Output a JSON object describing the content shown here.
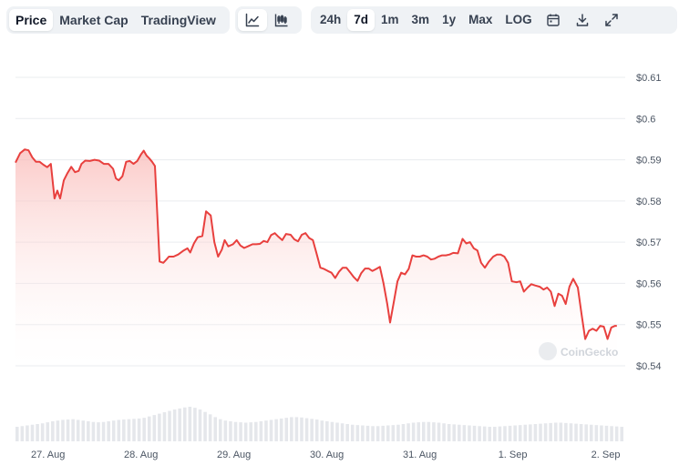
{
  "toolbar": {
    "data_tabs": [
      "Price",
      "Market Cap",
      "TradingView"
    ],
    "active_data_tab": "Price",
    "chart_style_icons": [
      "line-chart-icon",
      "candlestick-chart-icon"
    ],
    "active_chart_style": "line-chart-icon",
    "ranges": [
      "24h",
      "7d",
      "1m",
      "3m",
      "1y",
      "Max",
      "LOG"
    ],
    "active_range": "7d",
    "action_icons": [
      "calendar-icon",
      "download-icon",
      "expand-icon"
    ]
  },
  "watermark": "CoinGecko",
  "colors": {
    "line": "#e8403e",
    "fill_top": "#f9b4b1",
    "volume": "#e5e7eb",
    "grid": "#e9ecef",
    "active_bg": "#ffffff",
    "group_bg": "#eff2f5"
  },
  "chart_data": {
    "type": "area",
    "y_axis_side": "right",
    "ylim": [
      0.54,
      0.61
    ],
    "yticks": [
      0.54,
      0.55,
      0.56,
      0.57,
      0.58,
      0.59,
      0.6,
      0.61
    ],
    "ytick_labels": [
      "$0.54",
      "$0.55",
      "$0.56",
      "$0.57",
      "$0.58",
      "$0.59",
      "$0.6",
      "$0.61"
    ],
    "xlim": [
      -0.35,
      6.21
    ],
    "xticks": [
      0,
      1,
      2,
      3,
      4,
      5,
      6
    ],
    "xtick_labels": [
      "27. Aug",
      "28. Aug",
      "29. Aug",
      "30. Aug",
      "31. Aug",
      "1. Sep",
      "2. Sep"
    ],
    "grid": true,
    "series": [
      {
        "values": [
          [
            -0.35,
            0.5893
          ],
          [
            -0.3,
            0.5916
          ],
          [
            -0.25,
            0.5925
          ],
          [
            -0.21,
            0.5923
          ],
          [
            -0.17,
            0.5906
          ],
          [
            -0.13,
            0.5895
          ],
          [
            -0.09,
            0.5895
          ],
          [
            -0.05,
            0.5888
          ],
          [
            -0.01,
            0.5882
          ],
          [
            0.03,
            0.589
          ],
          [
            0.07,
            0.5806
          ],
          [
            0.1,
            0.5825
          ],
          [
            0.13,
            0.5806
          ],
          [
            0.17,
            0.585
          ],
          [
            0.21,
            0.5868
          ],
          [
            0.25,
            0.5883
          ],
          [
            0.29,
            0.587
          ],
          [
            0.33,
            0.5873
          ],
          [
            0.36,
            0.589
          ],
          [
            0.4,
            0.5898
          ],
          [
            0.45,
            0.5897
          ],
          [
            0.5,
            0.59
          ],
          [
            0.55,
            0.5898
          ],
          [
            0.6,
            0.589
          ],
          [
            0.65,
            0.589
          ],
          [
            0.7,
            0.5878
          ],
          [
            0.73,
            0.5855
          ],
          [
            0.76,
            0.585
          ],
          [
            0.8,
            0.586
          ],
          [
            0.84,
            0.5895
          ],
          [
            0.88,
            0.5897
          ],
          [
            0.92,
            0.589
          ],
          [
            0.96,
            0.5897
          ],
          [
            1.0,
            0.5913
          ],
          [
            1.03,
            0.5922
          ],
          [
            1.06,
            0.591
          ],
          [
            1.09,
            0.5903
          ],
          [
            1.12,
            0.5895
          ],
          [
            1.15,
            0.5885
          ],
          [
            1.2,
            0.5653
          ],
          [
            1.24,
            0.565
          ],
          [
            1.27,
            0.5657
          ],
          [
            1.3,
            0.5665
          ],
          [
            1.35,
            0.5665
          ],
          [
            1.4,
            0.567
          ],
          [
            1.46,
            0.568
          ],
          [
            1.5,
            0.5685
          ],
          [
            1.53,
            0.5675
          ],
          [
            1.57,
            0.5697
          ],
          [
            1.61,
            0.5712
          ],
          [
            1.66,
            0.5715
          ],
          [
            1.7,
            0.5775
          ],
          [
            1.75,
            0.5765
          ],
          [
            1.79,
            0.57
          ],
          [
            1.83,
            0.5665
          ],
          [
            1.87,
            0.5682
          ],
          [
            1.9,
            0.5705
          ],
          [
            1.94,
            0.569
          ],
          [
            1.99,
            0.5695
          ],
          [
            2.03,
            0.5705
          ],
          [
            2.07,
            0.5692
          ],
          [
            2.11,
            0.5686
          ],
          [
            2.15,
            0.569
          ],
          [
            2.2,
            0.5695
          ],
          [
            2.24,
            0.5695
          ],
          [
            2.28,
            0.5696
          ],
          [
            2.32,
            0.5703
          ],
          [
            2.36,
            0.57
          ],
          [
            2.4,
            0.5717
          ],
          [
            2.44,
            0.5722
          ],
          [
            2.48,
            0.5713
          ],
          [
            2.52,
            0.5705
          ],
          [
            2.56,
            0.572
          ],
          [
            2.61,
            0.5718
          ],
          [
            2.65,
            0.5707
          ],
          [
            2.69,
            0.5702
          ],
          [
            2.73,
            0.5718
          ],
          [
            2.77,
            0.5722
          ],
          [
            2.81,
            0.571
          ],
          [
            2.85,
            0.5705
          ],
          [
            2.89,
            0.5672
          ],
          [
            2.93,
            0.5638
          ],
          [
            2.97,
            0.5635
          ],
          [
            3.01,
            0.563
          ],
          [
            3.05,
            0.5626
          ],
          [
            3.09,
            0.5613
          ],
          [
            3.13,
            0.5628
          ],
          [
            3.17,
            0.5638
          ],
          [
            3.21,
            0.5638
          ],
          [
            3.25,
            0.5627
          ],
          [
            3.29,
            0.5615
          ],
          [
            3.33,
            0.5606
          ],
          [
            3.37,
            0.5625
          ],
          [
            3.41,
            0.5636
          ],
          [
            3.45,
            0.5636
          ],
          [
            3.49,
            0.563
          ],
          [
            3.53,
            0.5635
          ],
          [
            3.57,
            0.564
          ],
          [
            3.61,
            0.56
          ],
          [
            3.65,
            0.555
          ],
          [
            3.68,
            0.5505
          ],
          [
            3.72,
            0.5555
          ],
          [
            3.76,
            0.5605
          ],
          [
            3.8,
            0.5626
          ],
          [
            3.84,
            0.5622
          ],
          [
            3.88,
            0.5635
          ],
          [
            3.92,
            0.5668
          ],
          [
            3.96,
            0.5665
          ],
          [
            4.0,
            0.5665
          ],
          [
            4.04,
            0.5668
          ],
          [
            4.08,
            0.5665
          ],
          [
            4.12,
            0.5658
          ],
          [
            4.16,
            0.566
          ],
          [
            4.2,
            0.5665
          ],
          [
            4.24,
            0.5668
          ],
          [
            4.28,
            0.5668
          ],
          [
            4.32,
            0.567
          ],
          [
            4.36,
            0.5674
          ],
          [
            4.41,
            0.5673
          ],
          [
            4.46,
            0.5708
          ],
          [
            4.5,
            0.5697
          ],
          [
            4.54,
            0.57
          ],
          [
            4.58,
            0.5685
          ],
          [
            4.62,
            0.568
          ],
          [
            4.66,
            0.565
          ],
          [
            4.7,
            0.5638
          ],
          [
            4.74,
            0.5652
          ],
          [
            4.79,
            0.5665
          ],
          [
            4.83,
            0.567
          ],
          [
            4.87,
            0.567
          ],
          [
            4.91,
            0.5665
          ],
          [
            4.95,
            0.565
          ],
          [
            4.99,
            0.5605
          ],
          [
            5.04,
            0.5603
          ],
          [
            5.08,
            0.5605
          ],
          [
            5.12,
            0.558
          ],
          [
            5.16,
            0.559
          ],
          [
            5.2,
            0.5598
          ],
          [
            5.24,
            0.5595
          ],
          [
            5.29,
            0.5592
          ],
          [
            5.33,
            0.5585
          ],
          [
            5.37,
            0.559
          ],
          [
            5.41,
            0.558
          ],
          [
            5.45,
            0.5545
          ],
          [
            5.49,
            0.5575
          ],
          [
            5.53,
            0.557
          ],
          [
            5.57,
            0.555
          ],
          [
            5.61,
            0.5592
          ],
          [
            5.65,
            0.5611
          ],
          [
            5.7,
            0.559
          ],
          [
            5.74,
            0.5525
          ],
          [
            5.78,
            0.5465
          ],
          [
            5.82,
            0.5485
          ],
          [
            5.86,
            0.549
          ],
          [
            5.9,
            0.5485
          ],
          [
            5.94,
            0.5497
          ],
          [
            5.98,
            0.5495
          ],
          [
            6.02,
            0.5465
          ],
          [
            6.06,
            0.5493
          ],
          [
            6.1,
            0.5497
          ],
          [
            6.12,
            0.5497
          ]
        ]
      }
    ],
    "volume": {
      "start": -0.35,
      "end": 6.21,
      "values": [
        0.42,
        0.44,
        0.46,
        0.48,
        0.5,
        0.52,
        0.55,
        0.58,
        0.6,
        0.62,
        0.63,
        0.64,
        0.62,
        0.6,
        0.58,
        0.56,
        0.55,
        0.56,
        0.58,
        0.6,
        0.62,
        0.63,
        0.64,
        0.65,
        0.66,
        0.68,
        0.72,
        0.76,
        0.8,
        0.84,
        0.88,
        0.92,
        0.95,
        0.98,
        1.0,
        0.97,
        0.92,
        0.85,
        0.78,
        0.7,
        0.64,
        0.6,
        0.58,
        0.56,
        0.55,
        0.54,
        0.55,
        0.56,
        0.58,
        0.6,
        0.62,
        0.64,
        0.66,
        0.68,
        0.7,
        0.7,
        0.69,
        0.67,
        0.65,
        0.63,
        0.6,
        0.58,
        0.56,
        0.54,
        0.52,
        0.5,
        0.48,
        0.47,
        0.46,
        0.45,
        0.44,
        0.44,
        0.45,
        0.46,
        0.47,
        0.48,
        0.5,
        0.52,
        0.54,
        0.55,
        0.56,
        0.56,
        0.55,
        0.54,
        0.52,
        0.5,
        0.49,
        0.48,
        0.47,
        0.46,
        0.45,
        0.44,
        0.43,
        0.42,
        0.42,
        0.43,
        0.44,
        0.45,
        0.46,
        0.47,
        0.48,
        0.49,
        0.5,
        0.51,
        0.52,
        0.53,
        0.54,
        0.54,
        0.53,
        0.52,
        0.51,
        0.5,
        0.49,
        0.48,
        0.47,
        0.46,
        0.45,
        0.44,
        0.43,
        0.42
      ]
    }
  }
}
